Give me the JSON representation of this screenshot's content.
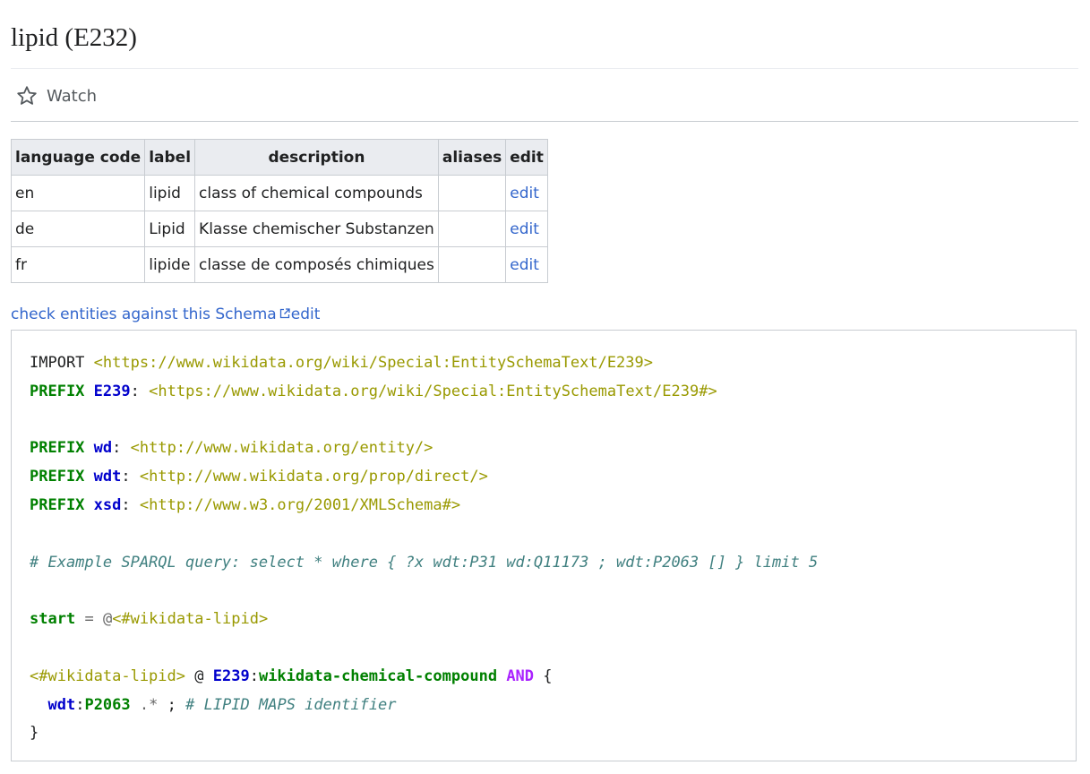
{
  "page": {
    "title": "lipid (E232)",
    "watch_label": "Watch"
  },
  "terms_table": {
    "headers": [
      "language code",
      "label",
      "description",
      "aliases",
      "edit"
    ],
    "rows": [
      {
        "lang": "en",
        "label": "lipid",
        "description": "class of chemical compounds",
        "aliases": "",
        "edit": "edit"
      },
      {
        "lang": "de",
        "label": "Lipid",
        "description": "Klasse chemischer Substanzen",
        "aliases": "",
        "edit": "edit"
      },
      {
        "lang": "fr",
        "label": "lipide",
        "description": "classe de composés chimiques",
        "aliases": "",
        "edit": "edit"
      }
    ]
  },
  "links": {
    "check_label": "check entities against this Schema",
    "edit_label": "edit"
  },
  "code": {
    "l1_kw": "IMPORT",
    "l1_iri": "<https://www.wikidata.org/wiki/Special:EntitySchemaText/E239>",
    "l2_kw": "PREFIX",
    "l2_pfx": "E239",
    "l2_iri": "<https://www.wikidata.org/wiki/Special:EntitySchemaText/E239#>",
    "l4_kw": "PREFIX",
    "l4_pfx": "wd",
    "l4_iri": "<http://www.wikidata.org/entity/>",
    "l5_kw": "PREFIX",
    "l5_pfx": "wdt",
    "l5_iri": "<http://www.wikidata.org/prop/direct/>",
    "l6_kw": "PREFIX",
    "l6_pfx": "xsd",
    "l6_iri": "<http://www.w3.org/2001/XMLSchema#>",
    "l8_comment": "# Example SPARQL query: select * where { ?x wdt:P31 wd:Q11173 ; wdt:P2063 [] } limit 5",
    "l10_kw": "start",
    "l10_op": "=",
    "l10_at": "@",
    "l10_ref": "<#wikidata-lipid>",
    "l12_shape": "<#wikidata-lipid>",
    "l12_at": "@",
    "l12_pfx": "E239",
    "l12_lname": "wikidata-chemical-compound",
    "l12_and": "AND",
    "l12_brace": "{",
    "l13_pfx": "wdt",
    "l13_prop": "P2063",
    "l13_val": ".*",
    "l13_semi": ";",
    "l13_comment": "# LIPID MAPS identifier",
    "l14_brace": "}"
  },
  "colors": {
    "link": "#3366cc",
    "keyword": "#008000",
    "prefix": "#0000cc",
    "iri": "#999900",
    "comment": "#408080",
    "and_keyword": "#aa22ff"
  },
  "icons": [
    "star-icon",
    "external-link-icon"
  ]
}
